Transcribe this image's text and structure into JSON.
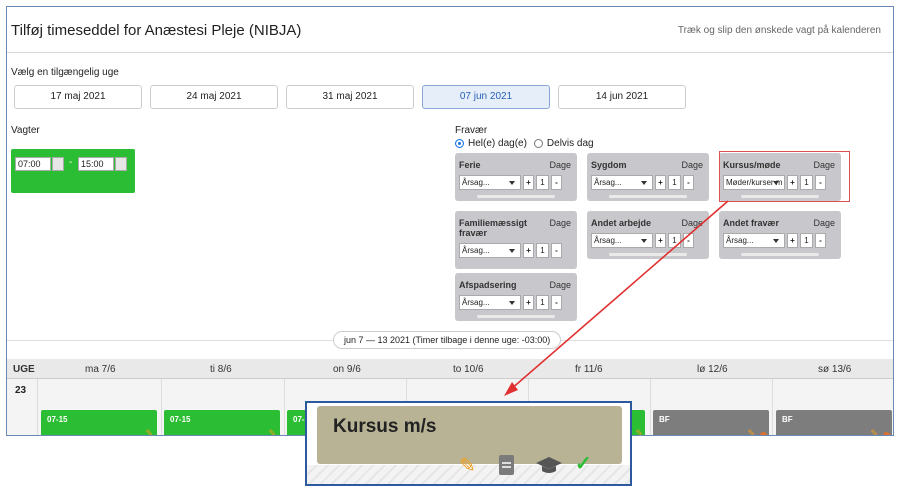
{
  "header": {
    "title": "Tilføj timeseddel for Anæstesi Pleje (NIBJA)",
    "hint": "Træk og slip den ønskede vagt på kalenderen"
  },
  "weeks": {
    "label": "Vælg en tilgængelig uge",
    "options": [
      "17 maj 2021",
      "24 maj 2021",
      "31 maj 2021",
      "07 jun 2021",
      "14 jun 2021"
    ],
    "selected": "07 jun 2021"
  },
  "vagter": {
    "label": "Vagter",
    "start": "07:00",
    "end": "15:00",
    "dash": "-"
  },
  "fravaer": {
    "label": "Fravær",
    "radio_full": "Hel(e) dag(e)",
    "radio_partial": "Delvis dag"
  },
  "absence": [
    {
      "title": "Ferie",
      "days_label": "Dage",
      "select": "Årsag...",
      "count": "1"
    },
    {
      "title": "Sygdom",
      "days_label": "Dage",
      "select": "Årsag...",
      "count": "1"
    },
    {
      "title": "Kursus/møde",
      "days_label": "Dage",
      "select": "Møder/kurser m",
      "count": "1"
    },
    {
      "title": "Familiemæssigt fravær",
      "days_label": "Dage",
      "select": "Årsag...",
      "count": "1"
    },
    {
      "title": "Andet arbejde",
      "days_label": "Dage",
      "select": "Årsag...",
      "count": "1"
    },
    {
      "title": "Andet fravær",
      "days_label": "Dage",
      "select": "Årsag...",
      "count": "1"
    },
    {
      "title": "Afspadsering",
      "days_label": "Dage",
      "select": "Årsag...",
      "count": "1"
    }
  ],
  "controls": {
    "plus": "+",
    "minus": "-"
  },
  "calendar": {
    "range": "jun 7 — 13 2021 (Timer tilbage i denne uge: -03:00)",
    "week_col": "UGE",
    "days": [
      "ma 7/6",
      "ti 8/6",
      "on 9/6",
      "to 10/6",
      "fr 11/6",
      "lø 12/6",
      "sø 13/6"
    ],
    "week_number": "23",
    "blocks": [
      "07-15",
      "07-15",
      "07-",
      "BF",
      "BF"
    ]
  },
  "zoom": {
    "label": "Kursus m/s"
  },
  "colors": {
    "green": "#2bbd33",
    "grey": "#7d7d7d",
    "accent": "#2a62b7",
    "highlight": "#e05050"
  }
}
